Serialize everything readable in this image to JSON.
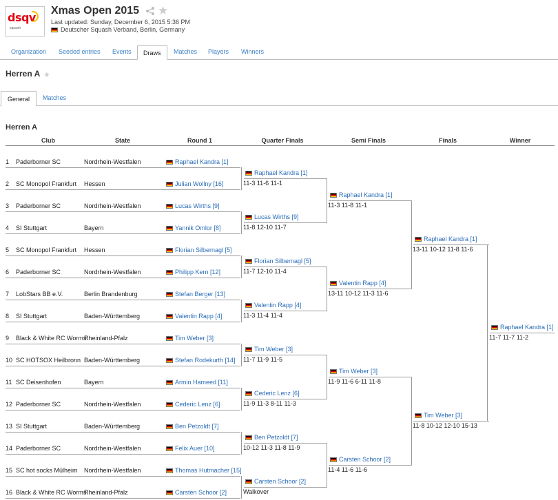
{
  "header": {
    "title": "Xmas Open 2015",
    "logo_text": "dsqv",
    "logo_sub": "squash",
    "last_updated": "Last updated: Sunday, December 6, 2015 5:36 PM",
    "location": "Deutscher Squash Verband, Berlin, Germany"
  },
  "tabs": [
    "Organization",
    "Seeded entries",
    "Events",
    "Draws",
    "Matches",
    "Players",
    "Winners"
  ],
  "active_tab": "Draws",
  "draw_title": "Herren A",
  "subtabs": [
    "General",
    "Matches"
  ],
  "active_subtab": "General",
  "section_title": "Herren A",
  "columns": [
    "Club",
    "State",
    "Round 1",
    "Quarter Finals",
    "Semi Finals",
    "Finals",
    "Winner"
  ],
  "round1": [
    {
      "no": "1",
      "club": "Paderborner SC",
      "state": "Nordrhein-Westfalen",
      "player": "Raphael Kandra [1]"
    },
    {
      "no": "2",
      "club": "SC Monopol Frankfurt",
      "state": "Hessen",
      "player": "Julian Wollny [16]"
    },
    {
      "no": "3",
      "club": "Paderborner SC",
      "state": "Nordrhein-Westfalen",
      "player": "Lucas Wirths [9]"
    },
    {
      "no": "4",
      "club": "SI Stuttgart",
      "state": "Bayern",
      "player": "Yannik Omlor [8]"
    },
    {
      "no": "5",
      "club": "SC Monopol Frankfurt",
      "state": "Hessen",
      "player": "Florian Silbernagl [5]"
    },
    {
      "no": "6",
      "club": "Paderborner SC",
      "state": "Nordrhein-Westfalen",
      "player": "Philipp Kern [12]"
    },
    {
      "no": "7",
      "club": "LobStars BB e.V.",
      "state": "Berlin Brandenburg",
      "player": "Stefan Berger [13]"
    },
    {
      "no": "8",
      "club": "SI Stuttgart",
      "state": "Baden-Württemberg",
      "player": "Valentin Rapp [4]"
    },
    {
      "no": "9",
      "club": "Black & White RC Worms",
      "state": "Rheinland-Pfalz",
      "player": "Tim Weber [3]"
    },
    {
      "no": "10",
      "club": "SC HOTSOX Heilbronn",
      "state": "Baden-Württemberg",
      "player": "Stefan Rodekurth [14]"
    },
    {
      "no": "11",
      "club": "SC Deisenhofen",
      "state": "Bayern",
      "player": "Armin Hameed [11]"
    },
    {
      "no": "12",
      "club": "Paderborner SC",
      "state": "Nordrhein-Westfalen",
      "player": "Cederic Lenz [6]"
    },
    {
      "no": "13",
      "club": "SI Stuttgart",
      "state": "Baden-Württemberg",
      "player": "Ben Petzoldt [7]"
    },
    {
      "no": "14",
      "club": "Paderborner SC",
      "state": "Nordrhein-Westfalen",
      "player": "Felix Auer [10]"
    },
    {
      "no": "15",
      "club": "SC hot socks Mülheim",
      "state": "Nordrhein-Westfalen",
      "player": "Thomas Hutmacher [15]"
    },
    {
      "no": "16",
      "club": "Black & White RC Worms",
      "state": "Rheinland-Pfalz",
      "player": "Carsten Schoor [2]"
    }
  ],
  "quarter_finals": [
    {
      "player": "Raphael Kandra [1]",
      "score": "11-3 11-6 11-1"
    },
    {
      "player": "Lucas Wirths [9]",
      "score": "11-8 12-10 11-7"
    },
    {
      "player": "Florian Silbernagl [5]",
      "score": "11-7 12-10 11-4"
    },
    {
      "player": "Valentin Rapp [4]",
      "score": "11-3 11-4 11-4"
    },
    {
      "player": "Tim Weber [3]",
      "score": "11-7 11-9 11-5"
    },
    {
      "player": "Cederic Lenz [6]",
      "score": "11-9 11-3 8-11 11-3"
    },
    {
      "player": "Ben Petzoldt [7]",
      "score": "10-12 11-3 11-8 11-9"
    },
    {
      "player": "Carsten Schoor [2]",
      "score": "Walkover"
    }
  ],
  "semi_finals": [
    {
      "player": "Raphael Kandra [1]",
      "score": "11-3 11-8 11-1"
    },
    {
      "player": "Valentin Rapp [4]",
      "score": "13-11 10-12 11-3 11-6"
    },
    {
      "player": "Tim Weber [3]",
      "score": "11-9 11-6 6-11 11-8"
    },
    {
      "player": "Carsten Schoor [2]",
      "score": "11-4 11-6 11-6"
    }
  ],
  "finals": [
    {
      "player": "Raphael Kandra [1]",
      "score": "13-11 10-12 11-8 11-6"
    },
    {
      "player": "Tim Weber [3]",
      "score": "11-8 10-12 12-10 15-13"
    }
  ],
  "winner": {
    "player": "Raphael Kandra [1]",
    "score": "11-7 11-7 11-2"
  }
}
